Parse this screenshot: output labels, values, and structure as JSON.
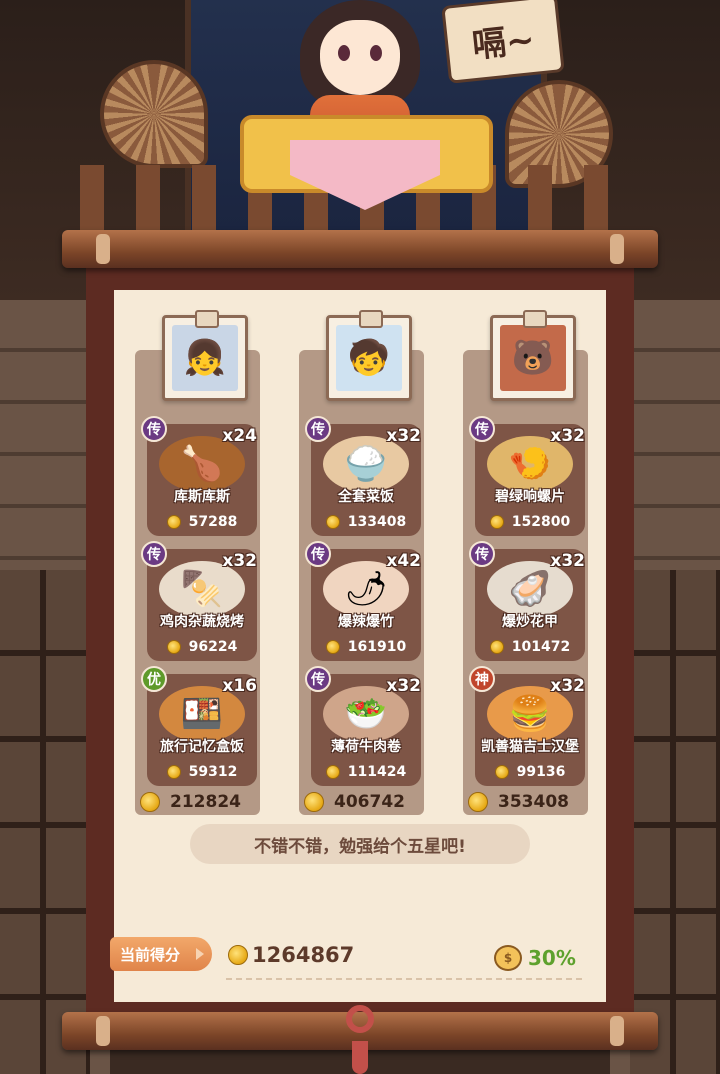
{
  "sign": {
    "text": "嗝~"
  },
  "columns": [
    {
      "avatar_icon": "traveler-girl-portrait",
      "total": "212824",
      "dishes": [
        {
          "tier": "传",
          "tier_color": "#6b3a83",
          "qty": "x24",
          "name": "库斯库斯",
          "price": "57288",
          "icon": "roast-chicken-plate"
        },
        {
          "tier": "传",
          "tier_color": "#6b3a83",
          "qty": "x32",
          "name": "鸡肉杂蔬烧烤",
          "price": "96224",
          "icon": "skewers-plate"
        },
        {
          "tier": "优",
          "tier_color": "#5e9a2a",
          "qty": "x16",
          "name": "旅行记忆盒饭",
          "price": "59312",
          "icon": "bento-box"
        }
      ]
    },
    {
      "avatar_icon": "blue-hair-boy-portrait",
      "total": "406742",
      "dishes": [
        {
          "tier": "传",
          "tier_color": "#6b3a83",
          "qty": "x32",
          "name": "全套菜饭",
          "price": "133408",
          "icon": "rice-set-bowl"
        },
        {
          "tier": "传",
          "tier_color": "#6b3a83",
          "qty": "x42",
          "name": "爆辣爆竹",
          "price": "161910",
          "icon": "spicy-bowl"
        },
        {
          "tier": "传",
          "tier_color": "#6b3a83",
          "qty": "x32",
          "name": "薄荷牛肉卷",
          "price": "111424",
          "icon": "mint-beef-roll"
        }
      ]
    },
    {
      "avatar_icon": "bear-portrait",
      "total": "353408",
      "dishes": [
        {
          "tier": "传",
          "tier_color": "#6b3a83",
          "qty": "x32",
          "name": "碧绿响螺片",
          "price": "152800",
          "icon": "conch-slices"
        },
        {
          "tier": "传",
          "tier_color": "#6b3a83",
          "qty": "x32",
          "name": "爆炒花甲",
          "price": "101472",
          "icon": "clams-plate"
        },
        {
          "tier": "神",
          "tier_color": "#c0452b",
          "qty": "x32",
          "name": "凯善猫吉士汉堡",
          "price": "99136",
          "icon": "cat-burger"
        }
      ]
    }
  ],
  "comment": "不错不错，勉强给个五星吧!",
  "score": {
    "label": "当前得分",
    "value": "1264867"
  },
  "bonus": {
    "percent": "30%",
    "icon": "coin-bag-icon"
  }
}
